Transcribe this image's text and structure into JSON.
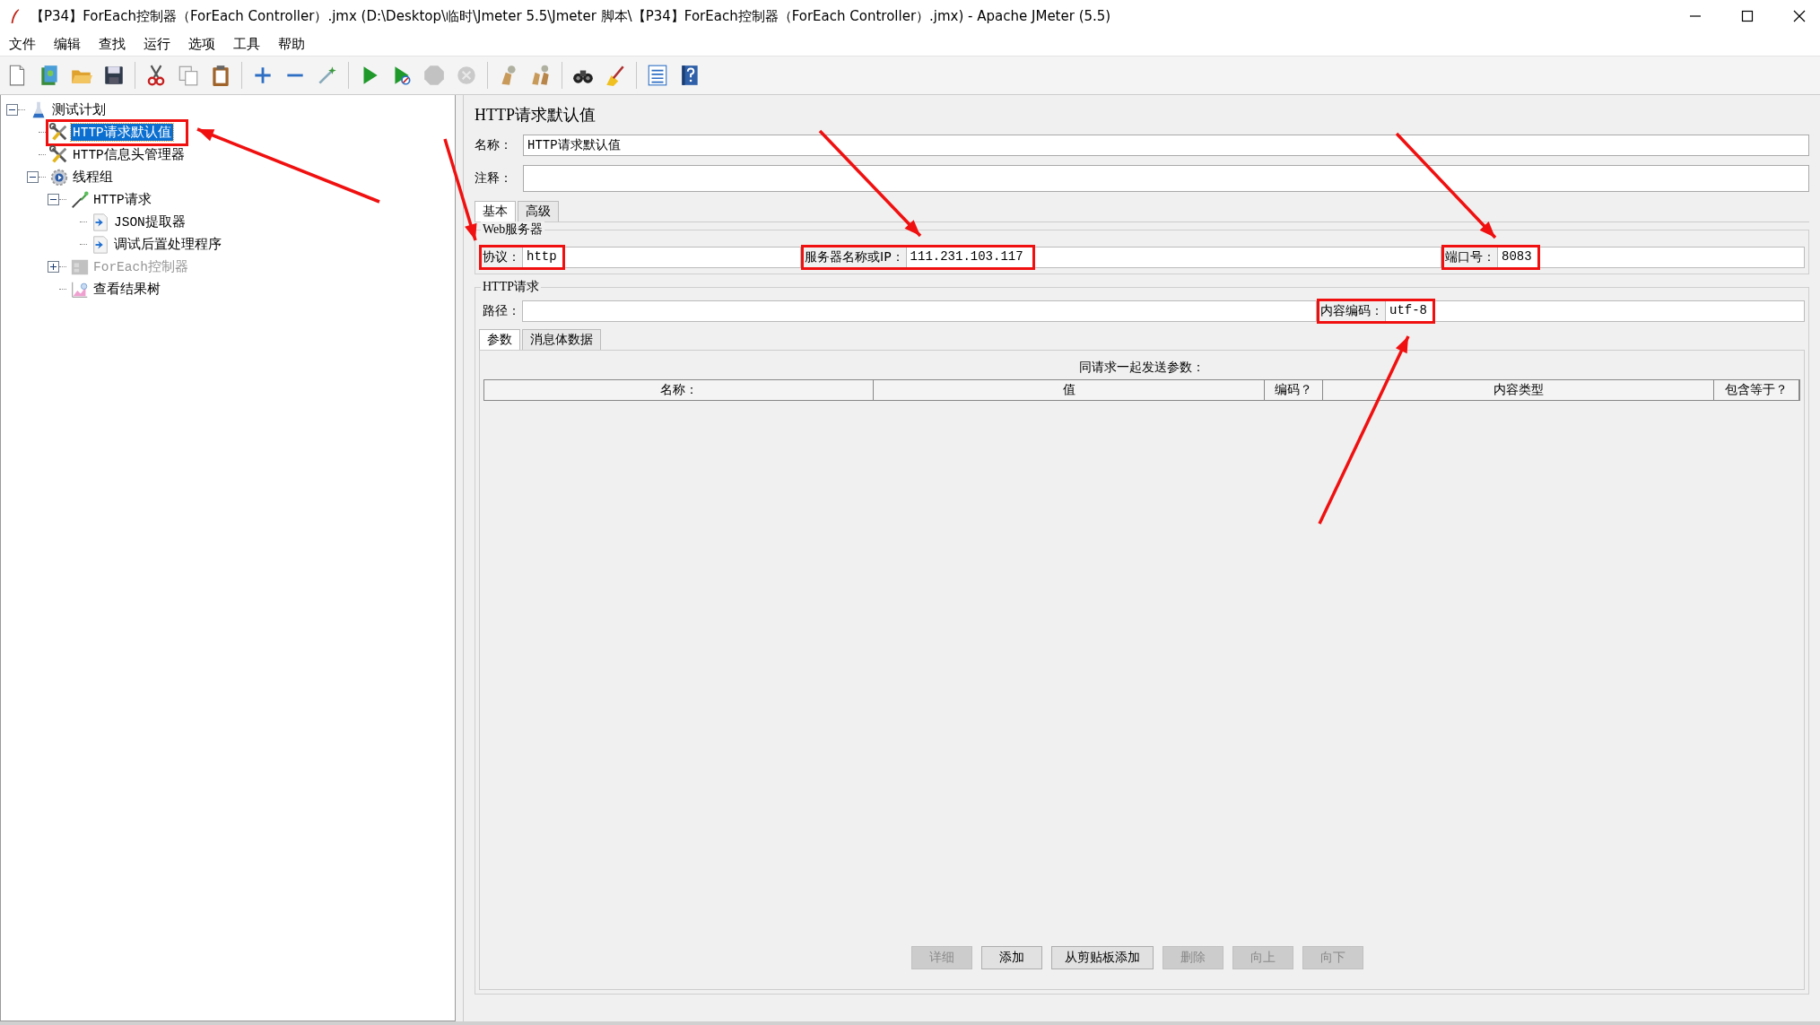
{
  "window": {
    "title": "【P34】ForEach控制器（ForEach Controller）.jmx (D:\\Desktop\\临时\\Jmeter 5.5\\Jmeter 脚本\\【P34】ForEach控制器（ForEach Controller）.jmx) - Apache JMeter (5.5)"
  },
  "menu": [
    "文件",
    "编辑",
    "查找",
    "运行",
    "选项",
    "工具",
    "帮助"
  ],
  "toolbar": [
    {
      "kind": "new",
      "disabled": false
    },
    {
      "kind": "templates",
      "disabled": false
    },
    {
      "kind": "open",
      "disabled": false
    },
    {
      "kind": "save",
      "disabled": false
    },
    {
      "kind": "separator"
    },
    {
      "kind": "cut",
      "disabled": false
    },
    {
      "kind": "copy",
      "disabled": false
    },
    {
      "kind": "paste",
      "disabled": false
    },
    {
      "kind": "separator"
    },
    {
      "kind": "expand",
      "disabled": false
    },
    {
      "kind": "collapse",
      "disabled": false
    },
    {
      "kind": "toggle",
      "disabled": false
    },
    {
      "kind": "separator"
    },
    {
      "kind": "start",
      "disabled": false
    },
    {
      "kind": "start-no-pause",
      "disabled": false
    },
    {
      "kind": "stop",
      "disabled": true
    },
    {
      "kind": "shutdown",
      "disabled": true
    },
    {
      "kind": "separator"
    },
    {
      "kind": "clear",
      "disabled": false
    },
    {
      "kind": "clear-all",
      "disabled": false
    },
    {
      "kind": "separator"
    },
    {
      "kind": "search",
      "disabled": false
    },
    {
      "kind": "reset-search",
      "disabled": false
    },
    {
      "kind": "separator"
    },
    {
      "kind": "functions",
      "disabled": false
    },
    {
      "kind": "help",
      "disabled": false
    }
  ],
  "tree": [
    {
      "label": "测试计划",
      "kind": "test-plan",
      "expanded": true,
      "selected": false,
      "disabled": false,
      "highlighted": false,
      "children": [
        {
          "label": "HTTP请求默认值",
          "kind": "config",
          "selected": true,
          "disabled": false,
          "highlighted": true
        },
        {
          "label": "HTTP信息头管理器",
          "kind": "config",
          "selected": false,
          "disabled": false,
          "highlighted": false
        },
        {
          "label": "线程组",
          "kind": "thread-group",
          "expanded": true,
          "selected": false,
          "disabled": false,
          "highlighted": false,
          "children": [
            {
              "label": "HTTP请求",
              "kind": "sampler",
              "expanded": true,
              "selected": false,
              "disabled": false,
              "highlighted": false,
              "children": [
                {
                  "label": "JSON提取器",
                  "kind": "post-processor",
                  "selected": false,
                  "disabled": false,
                  "highlighted": false
                },
                {
                  "label": "调试后置处理程序",
                  "kind": "post-processor",
                  "selected": false,
                  "disabled": false,
                  "highlighted": false
                }
              ]
            },
            {
              "label": "ForEach控制器",
              "kind": "controller",
              "expanded": false,
              "selected": false,
              "disabled": true,
              "highlighted": false
            },
            {
              "label": "查看结果树",
              "kind": "listener",
              "selected": false,
              "disabled": false,
              "highlighted": false
            }
          ]
        }
      ]
    }
  ],
  "editor": {
    "title": "HTTP请求默认值",
    "name": {
      "label": "名称：",
      "value": "HTTP请求默认值"
    },
    "comment": {
      "label": "注释："
    },
    "tabs": [
      {
        "label": "基本",
        "selected": true
      },
      {
        "label": "高级",
        "selected": false
      }
    ],
    "web_server": {
      "legend": "Web服务器",
      "fields": [
        {
          "label": "协议：",
          "value": "http",
          "highlighted": true
        },
        {
          "label": "服务器名称或IP：",
          "value": "111.231.103.117",
          "highlighted": true
        },
        {
          "label": "端口号：",
          "value": "8083",
          "highlighted": true
        }
      ]
    },
    "http_request": {
      "legend": "HTTP请求",
      "fields": [
        {
          "label": "路径：",
          "highlighted": false
        },
        {
          "label": "内容编码：",
          "value": "utf-8",
          "highlighted": true
        }
      ]
    },
    "param_tabs": [
      {
        "label": "参数",
        "selected": true
      },
      {
        "label": "消息体数据",
        "selected": false
      }
    ],
    "params_table": {
      "caption": "同请求一起发送参数：",
      "columns": [
        "名称：",
        "值",
        "编码？",
        "内容类型",
        "包含等于？"
      ]
    },
    "buttons": [
      {
        "label": "详细",
        "disabled": true
      },
      {
        "label": "添加",
        "disabled": false
      },
      {
        "label": "从剪贴板添加",
        "disabled": false
      },
      {
        "label": "删除",
        "disabled": true
      },
      {
        "label": "向上",
        "disabled": true
      },
      {
        "label": "向下",
        "disabled": true
      }
    ]
  }
}
